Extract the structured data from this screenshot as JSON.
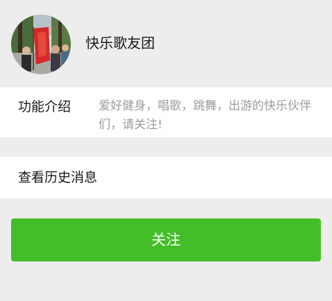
{
  "profile": {
    "name": "快乐歌友团",
    "avatar_icon": "group-photo-avatar"
  },
  "intro": {
    "label": "功能介绍",
    "text": "爱好健身，唱歌，跳舞，出游的快乐伙伴们，请关注!"
  },
  "history": {
    "label": "查看历史消息"
  },
  "follow": {
    "label": "关注"
  },
  "colors": {
    "background": "#ededed",
    "card": "#ffffff",
    "accent": "#44be28",
    "secondary_text": "#9b9b9b",
    "primary_text": "#191919"
  }
}
